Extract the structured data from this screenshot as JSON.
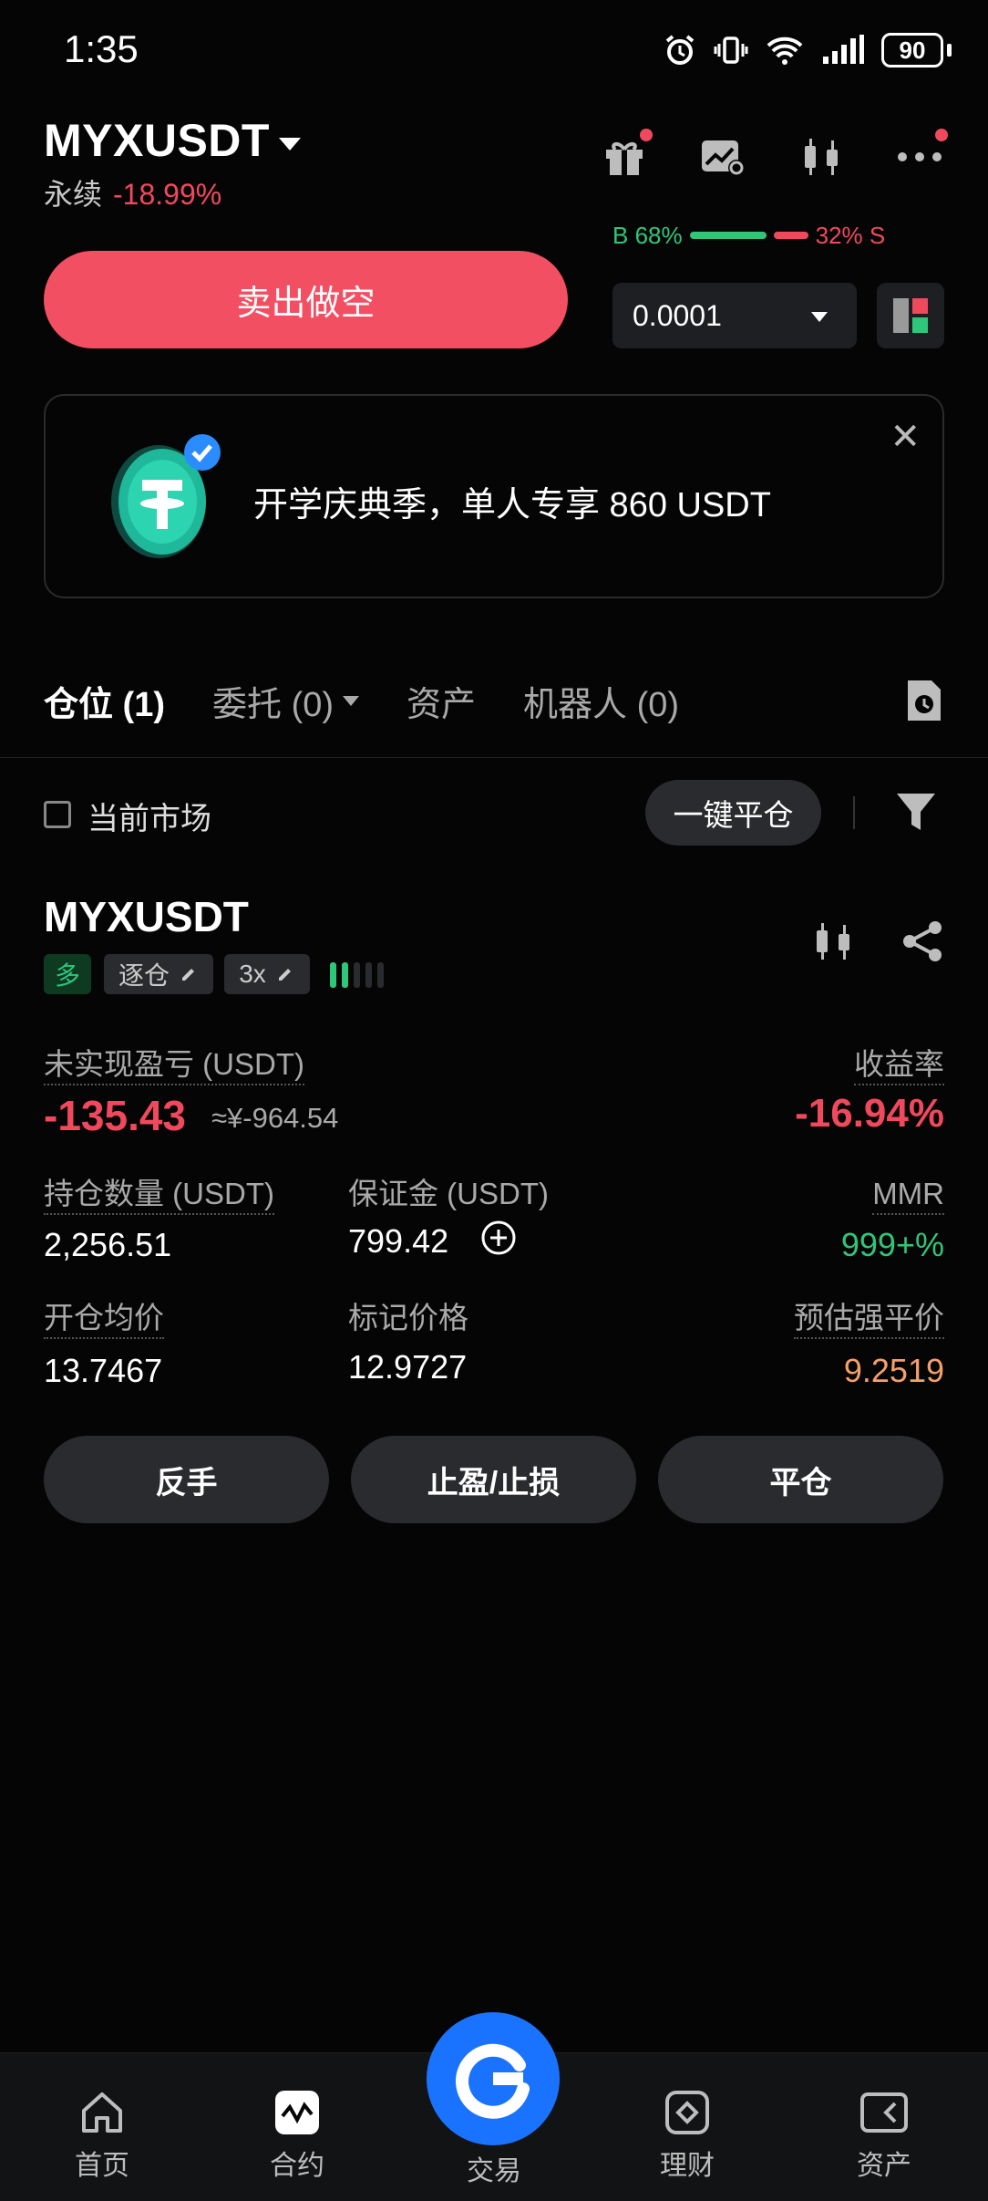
{
  "status_bar": {
    "time": "1:35",
    "battery": "90"
  },
  "header": {
    "pair": "MYXUSDT",
    "type": "永续",
    "change": "-18.99%"
  },
  "trade": {
    "sell_label": "卖出做空",
    "buy_ratio": "B 68%",
    "sell_ratio": "32% S",
    "buy_percent": 68,
    "precision": "0.0001"
  },
  "promo": {
    "text": "开学庆典季，单人专享 860 USDT"
  },
  "tabs": [
    {
      "label": "仓位 (1)"
    },
    {
      "label": "委托 (0)"
    },
    {
      "label": "资产"
    },
    {
      "label": "机器人 (0)"
    }
  ],
  "filter": {
    "current_market": "当前市场",
    "close_all": "一键平仓"
  },
  "position": {
    "symbol": "MYXUSDT",
    "side": "多",
    "margin_mode": "逐仓",
    "leverage": "3x",
    "adl_level": 2,
    "unrealized_label": "未实现盈亏 (USDT)",
    "unrealized_value": "-135.43",
    "unrealized_cny": "≈¥-964.54",
    "roi_label": "收益率",
    "roi_value": "-16.94%",
    "size_label": "持仓数量 (USDT)",
    "size_value": "2,256.51",
    "margin_label": "保证金 (USDT)",
    "margin_value": "799.42",
    "mmr_label": "MMR",
    "mmr_value": "999+%",
    "entry_label": "开仓均价",
    "entry_value": "13.7467",
    "mark_label": "标记价格",
    "mark_value": "12.9727",
    "liq_label": "预估强平价",
    "liq_value": "9.2519"
  },
  "actions": {
    "reverse": "反手",
    "tpsl": "止盈/止损",
    "close": "平仓"
  },
  "nav": [
    {
      "label": "首页",
      "icon": "home-icon"
    },
    {
      "label": "合约",
      "icon": "futures-icon"
    },
    {
      "label": "交易",
      "icon": "trade-icon"
    },
    {
      "label": "理财",
      "icon": "earn-icon"
    },
    {
      "label": "资产",
      "icon": "assets-icon"
    }
  ],
  "colors": {
    "negative": "#f0495d",
    "positive": "#2ec77a",
    "liq": "#f4a06b",
    "accent": "#1a73ff"
  }
}
